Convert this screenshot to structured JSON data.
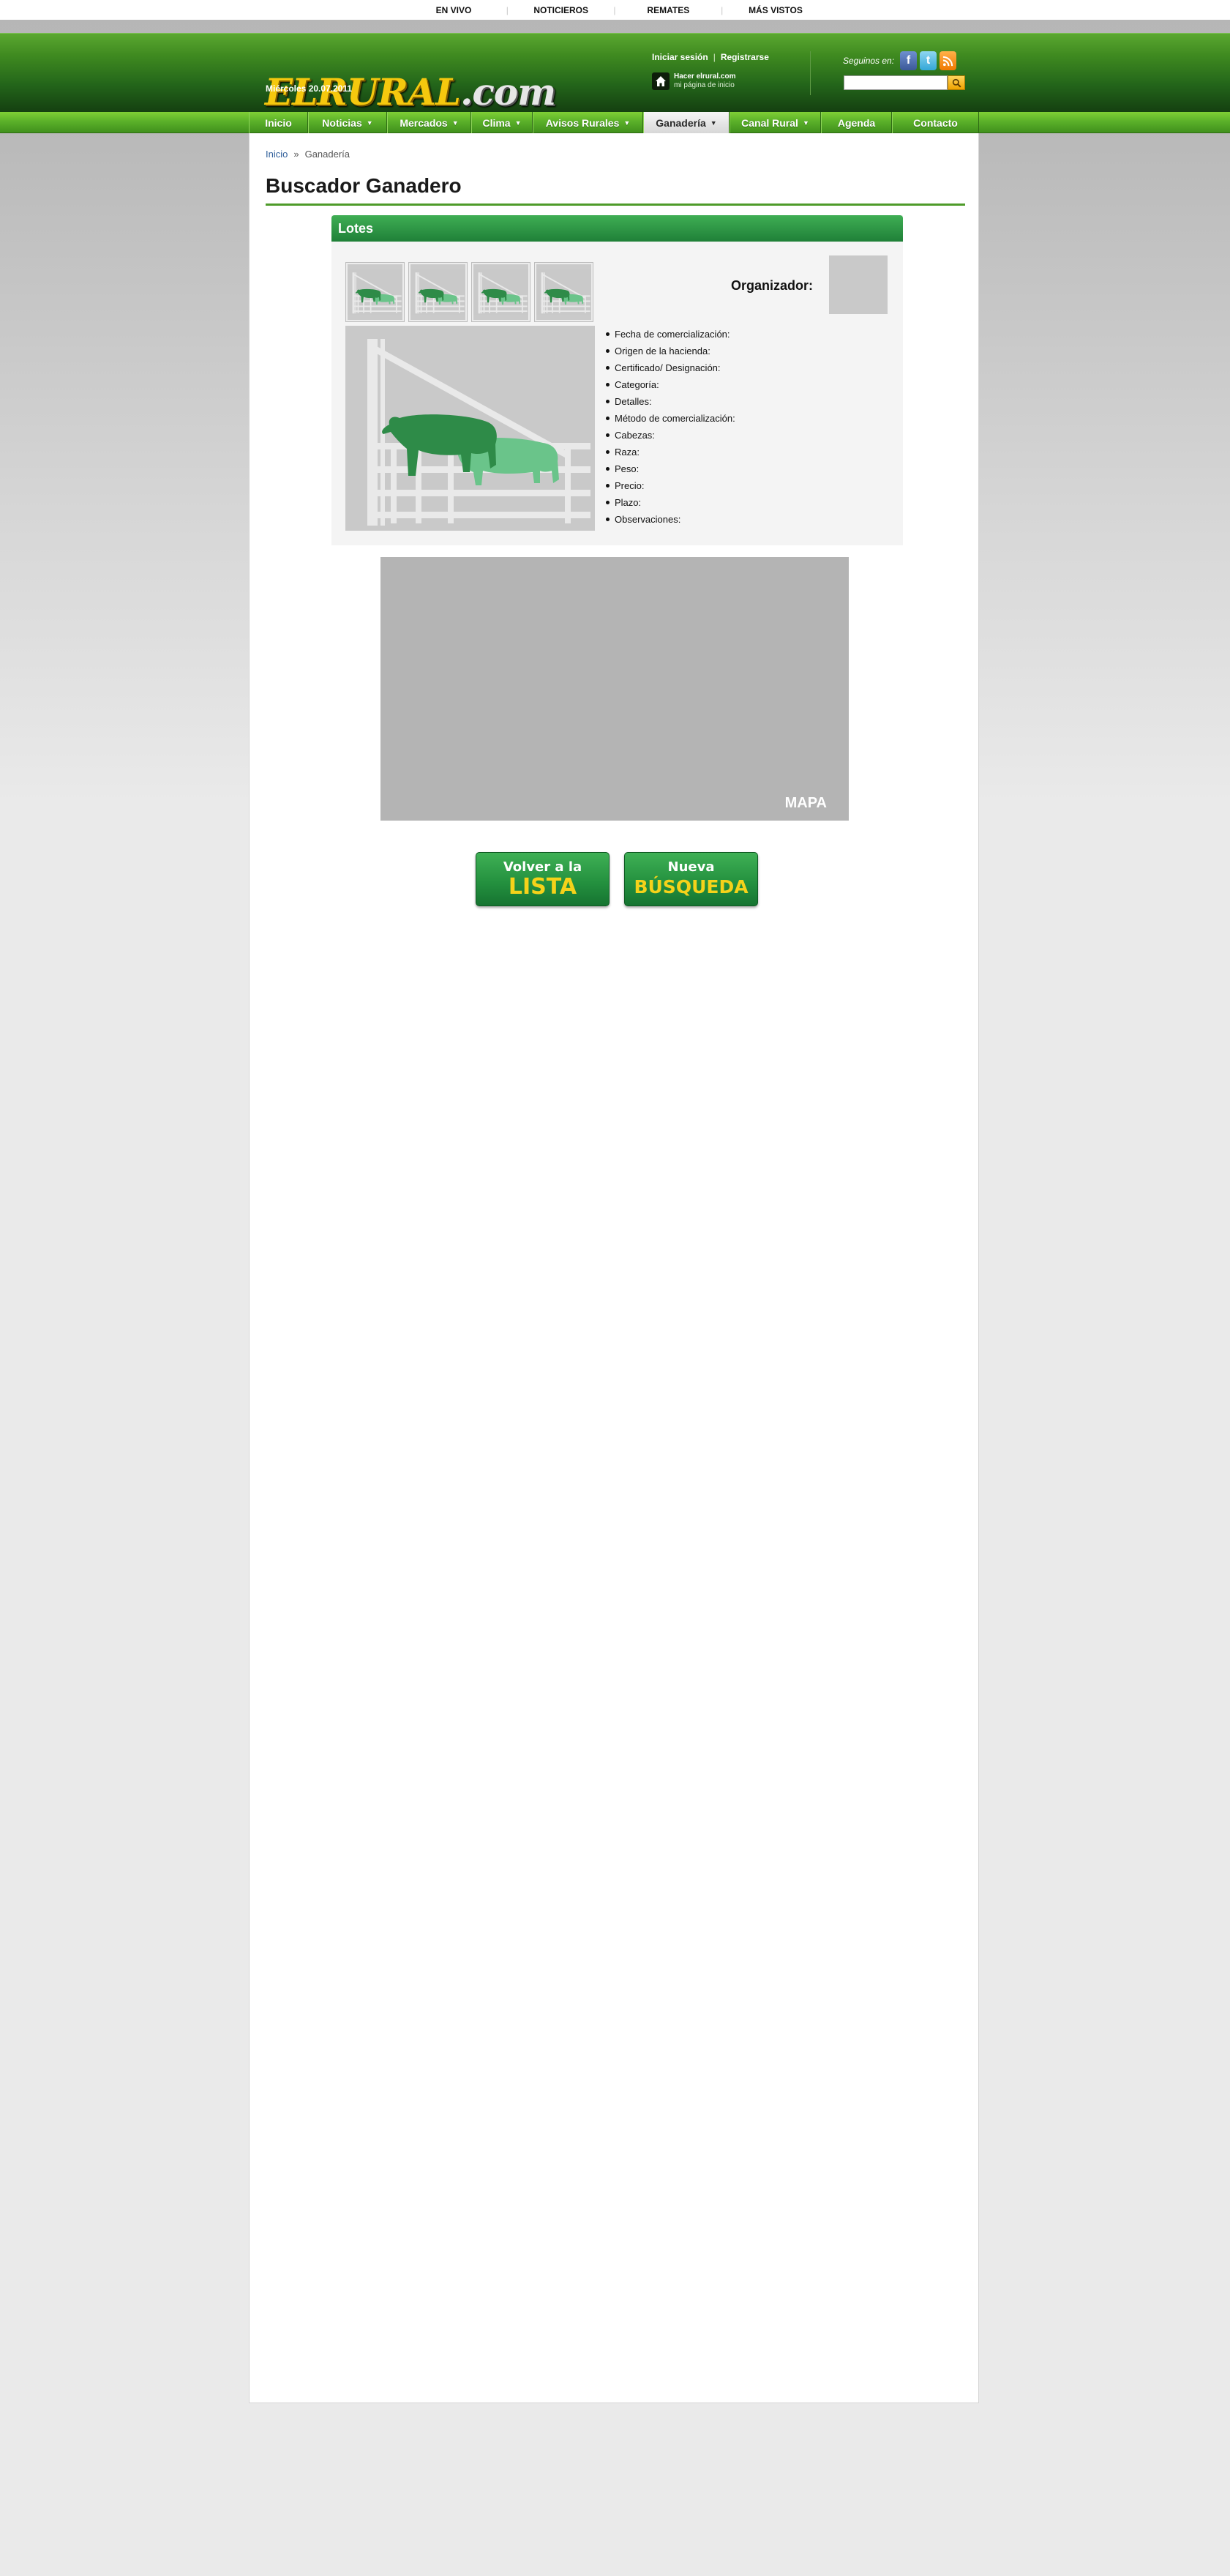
{
  "topbar": {
    "links": [
      "EN VIVO",
      "NOTICIEROS",
      "REMATES",
      "MÁS VISTOS"
    ]
  },
  "header": {
    "logo_main": "ELRURAL",
    "logo_suffix": ".com",
    "date": "Miércoles 20.07.2011",
    "login_label": "Iniciar sesión",
    "register_label": "Registrarse",
    "homepage_line1": "Hacer elrural.com",
    "homepage_line2": "mi página de inicio",
    "follow_label": "Seguinos en:",
    "social": [
      {
        "name": "facebook",
        "glyph": "f",
        "color": "#3b5998"
      },
      {
        "name": "twitter",
        "glyph": "t",
        "color": "#33a7d8"
      },
      {
        "name": "rss",
        "glyph": "))",
        "color": "#f07800"
      }
    ],
    "search_value": ""
  },
  "nav": {
    "items": [
      {
        "label": "Inicio",
        "caret": "",
        "active": false
      },
      {
        "label": "Noticias",
        "caret": "▼",
        "active": false
      },
      {
        "label": "Mercados",
        "caret": "▼",
        "active": false
      },
      {
        "label": "Clima",
        "caret": "▼",
        "active": false
      },
      {
        "label": "Avisos Rurales",
        "caret": "▼",
        "active": false
      },
      {
        "label": "Ganadería",
        "caret": "▼",
        "active": true
      },
      {
        "label": "Canal Rural",
        "caret": "▼",
        "active": false
      },
      {
        "label": "Agenda",
        "caret": "",
        "active": false
      },
      {
        "label": "Contacto",
        "caret": "",
        "active": false
      }
    ]
  },
  "breadcrumb": {
    "home": "Inicio",
    "separator": "»",
    "current": "Ganadería"
  },
  "page": {
    "title": "Buscador Ganadero"
  },
  "lotes": {
    "header": "Lotes",
    "organizer_label": "Organizador:",
    "details": [
      "Fecha de comercialización:",
      "Origen de la hacienda:",
      "Certificado/ Designación:",
      "Categoría:",
      "Detalles:",
      "Método de comercialización:",
      "Cabezas:",
      "Raza:",
      "Peso:",
      "Precio:",
      "Plazo:",
      "Observaciones:"
    ]
  },
  "map": {
    "label": "MAPA"
  },
  "buttons": {
    "back_line1": "Volver a la",
    "back_line2": "LISTA",
    "new_line1": "Nueva",
    "new_line2": "BÚSQUEDA"
  },
  "colors": {
    "brand_green": "#2e8b2a",
    "accent_yellow": "#f5c80e",
    "cattle_dark": "#2e8b48",
    "cattle_light": "#6ac48a"
  }
}
